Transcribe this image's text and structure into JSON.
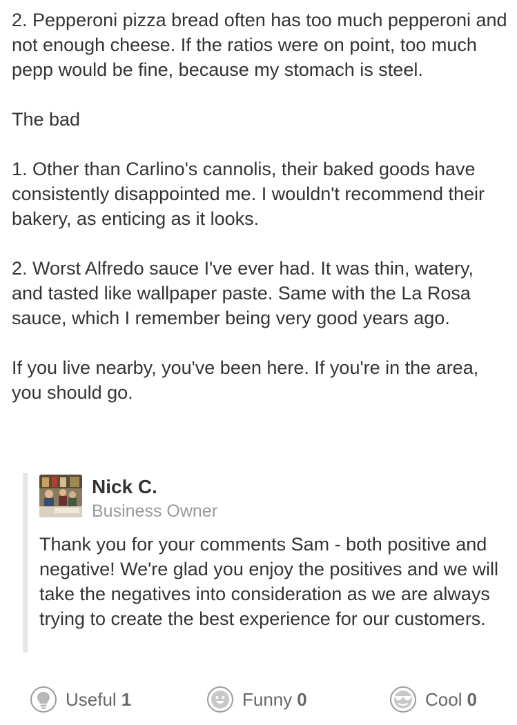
{
  "review": {
    "paragraphs": [
      "2. Pepperoni pizza bread often has too much pepperoni and not enough cheese. If the ratios were on point, too much pepp would be fine, because my stomach is steel.",
      "The bad",
      "1. Other than Carlino's cannolis, their baked goods have consistently disappointed me. I wouldn't recommend their bakery, as enticing as it looks.",
      "2. Worst Alfredo sauce I've ever had. It was thin, watery, and tasted like wallpaper paste. Same with the La Rosa sauce, which I remember being very good years ago.",
      "If you live nearby, you've been here. If you're in the area, you should go."
    ]
  },
  "owner_reply": {
    "name": "Nick C.",
    "role": "Business Owner",
    "text": "Thank you for your comments Sam - both positive and negative! We're glad you enjoy the positives and we will take the negatives into consideration as we are always trying to create the best experience for our customers."
  },
  "actions": {
    "useful": {
      "label": "Useful",
      "count": "1",
      "icon": "lightbulb-icon"
    },
    "funny": {
      "label": "Funny",
      "count": "0",
      "icon": "smiley-face-icon"
    },
    "cool": {
      "label": "Cool",
      "count": "0",
      "icon": "sunglasses-face-icon"
    }
  },
  "colors": {
    "text": "#333333",
    "secondary_text": "#999999",
    "action_text": "#666666",
    "reply_border": "#e6e6e6",
    "icon_stroke": "#9a9a9a"
  }
}
